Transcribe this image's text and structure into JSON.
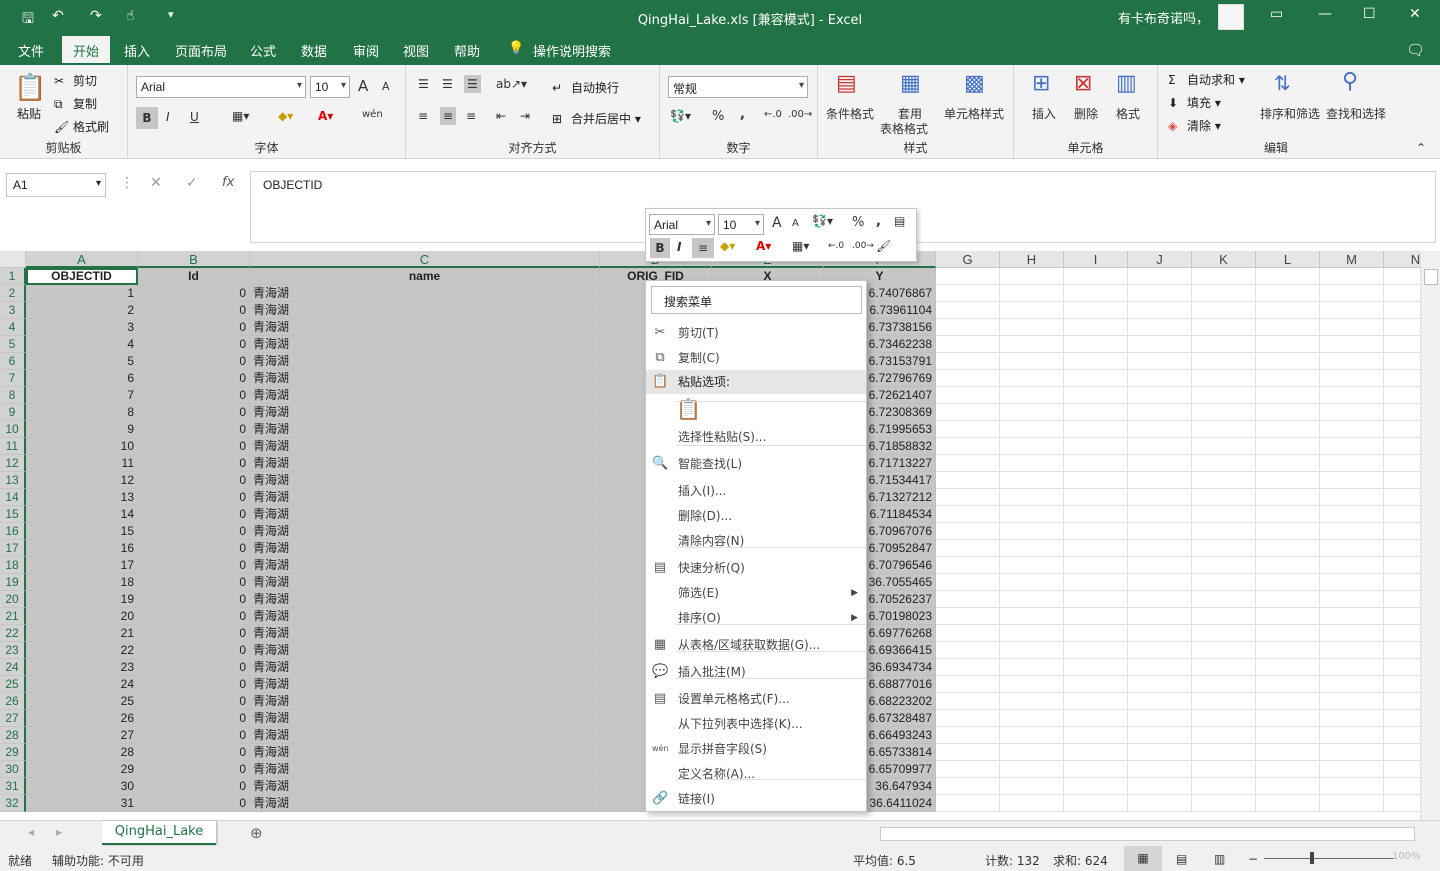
{
  "titlebar": {
    "title": "QingHai_Lake.xls  [兼容模式]  -  Excel",
    "user": "有卡布奇诺吗，",
    "save": "🖫",
    "undo": "↶",
    "redo": "↷",
    "touch": "☝",
    "customize": "▾",
    "ribbon_display": "▭",
    "minimize": "—",
    "maximize": "☐",
    "close": "✕"
  },
  "tabs": [
    {
      "label": "文件"
    },
    {
      "label": "开始"
    },
    {
      "label": "插入"
    },
    {
      "label": "页面布局"
    },
    {
      "label": "公式"
    },
    {
      "label": "数据"
    },
    {
      "label": "审阅"
    },
    {
      "label": "视图"
    },
    {
      "label": "帮助"
    },
    {
      "label": "操作说明搜索"
    }
  ],
  "ribbon": {
    "clipboard": {
      "label": "剪贴板",
      "paste": "粘贴",
      "cut": "剪切",
      "copy": "复制",
      "painter": "格式刷"
    },
    "font": {
      "label": "字体",
      "name": "Arial",
      "size": "10",
      "bold": "B",
      "italic": "I",
      "underline": "U",
      "grow": "A",
      "shrink": "A",
      "phonetic": "wén"
    },
    "align": {
      "label": "对齐方式",
      "wrap": "自动换行",
      "merge": "合并后居中"
    },
    "number": {
      "label": "数字",
      "format": "常规",
      "percent": "%",
      "comma": ","
    },
    "styles": {
      "label": "样式",
      "cond": "条件格式",
      "table1": "套用",
      "table2": "表格格式",
      "cell": "单元格样式"
    },
    "cells": {
      "label": "单元格",
      "insert": "插入",
      "delete": "删除",
      "format": "格式"
    },
    "edit": {
      "label": "编辑",
      "autosum": "自动求和",
      "fill": "填充",
      "clear": "清除",
      "sort": "排序和筛选",
      "find": "查找和选择"
    }
  },
  "formula": {
    "namebox": "A1",
    "fx": "fx",
    "cancel": "✕",
    "enter": "✓",
    "value": "OBJECTID"
  },
  "columns": [
    "A",
    "B",
    "C",
    "D",
    "E",
    "F",
    "G",
    "H",
    "I",
    "J",
    "K",
    "L",
    "M",
    "N"
  ],
  "header_row": [
    "OBJECTID",
    "Id",
    "name",
    "ORIG_FID",
    "X",
    "Y"
  ],
  "rows": [
    [
      "1",
      "0",
      "青海湖",
      "6.74076867"
    ],
    [
      "2",
      "0",
      "青海湖",
      "6.73961104"
    ],
    [
      "3",
      "0",
      "青海湖",
      "6.73738156"
    ],
    [
      "4",
      "0",
      "青海湖",
      "6.73462238"
    ],
    [
      "5",
      "0",
      "青海湖",
      "6.73153791"
    ],
    [
      "6",
      "0",
      "青海湖",
      "6.72796769"
    ],
    [
      "7",
      "0",
      "青海湖",
      "6.72621407"
    ],
    [
      "8",
      "0",
      "青海湖",
      "6.72308369"
    ],
    [
      "9",
      "0",
      "青海湖",
      "6.71995653"
    ],
    [
      "10",
      "0",
      "青海湖",
      "6.71858832"
    ],
    [
      "11",
      "0",
      "青海湖",
      "6.71713227"
    ],
    [
      "12",
      "0",
      "青海湖",
      "6.71534417"
    ],
    [
      "13",
      "0",
      "青海湖",
      "6.71327212"
    ],
    [
      "14",
      "0",
      "青海湖",
      "6.71184534"
    ],
    [
      "15",
      "0",
      "青海湖",
      "6.70967076"
    ],
    [
      "16",
      "0",
      "青海湖",
      "6.70952847"
    ],
    [
      "17",
      "0",
      "青海湖",
      "6.70796546"
    ],
    [
      "18",
      "0",
      "青海湖",
      "36.7055465"
    ],
    [
      "19",
      "0",
      "青海湖",
      "6.70526237"
    ],
    [
      "20",
      "0",
      "青海湖",
      "6.70198023"
    ],
    [
      "21",
      "0",
      "青海湖",
      "6.69776268"
    ],
    [
      "22",
      "0",
      "青海湖",
      "6.69366415"
    ],
    [
      "23",
      "0",
      "青海湖",
      "36.6934734"
    ],
    [
      "24",
      "0",
      "青海湖",
      "6.68877016"
    ],
    [
      "25",
      "0",
      "青海湖",
      "6.68223202"
    ],
    [
      "26",
      "0",
      "青海湖",
      "6.67328487"
    ],
    [
      "27",
      "0",
      "青海湖",
      "6.66493243"
    ],
    [
      "28",
      "0",
      "青海湖",
      "6.65733814"
    ],
    [
      "29",
      "0",
      "青海湖",
      "6.65709977"
    ],
    [
      "30",
      "0",
      "青海湖",
      "36.647934"
    ],
    [
      "31",
      "0",
      "青海湖",
      "36.6411024"
    ]
  ],
  "row_numbers": [
    "1",
    "2",
    "3",
    "4",
    "5",
    "6",
    "7",
    "8",
    "9",
    "10",
    "11",
    "12",
    "13",
    "14",
    "15",
    "16",
    "17",
    "18",
    "19",
    "20",
    "21",
    "22",
    "23",
    "24",
    "25",
    "26",
    "27",
    "28",
    "29",
    "30",
    "31",
    "32"
  ],
  "mini_toolbar": {
    "font": "Arial",
    "size": "10",
    "bold": "B",
    "italic": "I"
  },
  "context_menu": {
    "search": "搜索菜单",
    "items": [
      "剪切(T)",
      "复制(C)",
      "粘贴选项:",
      "选择性粘贴(S)...",
      "智能查找(L)",
      "插入(I)...",
      "删除(D)...",
      "清除内容(N)",
      "快速分析(Q)",
      "筛选(E)",
      "排序(O)",
      "从表格/区域获取数据(G)...",
      "插入批注(M)",
      "设置单元格格式(F)...",
      "从下拉列表中选择(K)...",
      "显示拼音字段(S)",
      "定义名称(A)...",
      "链接(I)"
    ]
  },
  "sheet_tab": "QingHai_Lake",
  "status": {
    "ready": "就绪",
    "accessibility": "辅助功能: 不可用",
    "average": "平均值: 6.5",
    "count": "计数: 132",
    "sum": "求和: 624",
    "zoom": "100%"
  },
  "colors": {
    "accent": "#217346",
    "selection": "#c6c6c6"
  }
}
